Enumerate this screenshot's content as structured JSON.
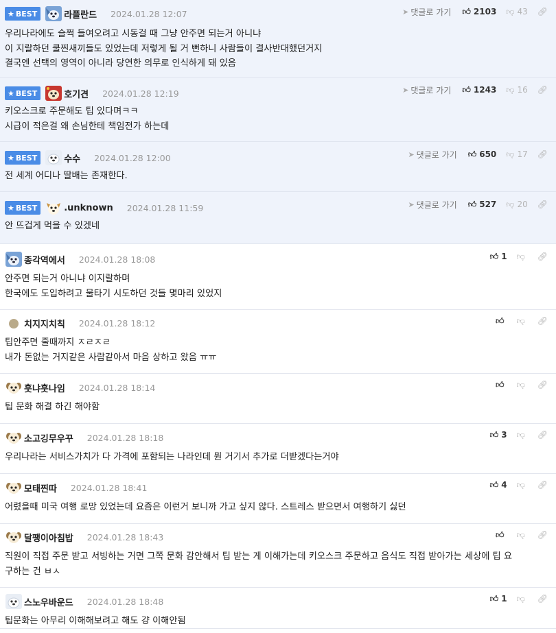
{
  "best_label": "BEST",
  "reply_label": "댓글로 가기",
  "colors": {
    "best_badge": "#4a8ce6",
    "best_bg": "#eff3fb"
  },
  "comments": [
    {
      "best": true,
      "nick": "라플란드",
      "date": "2024.01.28 12:07",
      "up": "2103",
      "down": "43",
      "avatar": "blue-puppy-icon",
      "lines": [
        "우리나라에도 슬쩍 들여오려고 시동걸 때 그냥 안주면 되는거 아니냐",
        "이 지랄하던 쿨찐새끼들도 있었는데 저렇게 될 거 뻔하니 사람들이 결사반대했던거지",
        "결국엔 선택의 영역이 아니라 당연한 의무로 인식하게 돼 있음"
      ]
    },
    {
      "best": true,
      "nick": "호기견",
      "date": "2024.01.28 12:19",
      "up": "1243",
      "down": "16",
      "avatar": "red-puppy-icon",
      "lines": [
        "키오스크로 주문해도 팁 있다며ㅋㅋ",
        "시급이 적은걸 왜 손님한테 책임전가 하는데"
      ]
    },
    {
      "best": true,
      "nick": "수수",
      "date": "2024.01.28 12:00",
      "up": "650",
      "down": "17",
      "avatar": "white-puppy-icon",
      "lines": [
        "전 세계 어디나 딸배는 존재한다."
      ]
    },
    {
      "best": true,
      "nick": ".unknown",
      "date": "2024.01.28 11:59",
      "up": "527",
      "down": "20",
      "avatar": "brown-puppy-icon",
      "lines": [
        "안 뜨겁게 먹을 수 있겠네"
      ]
    },
    {
      "best": false,
      "nick": "종각역에서",
      "date": "2024.01.28 18:08",
      "up": "1",
      "down": "",
      "avatar": "blue-puppy-icon",
      "lines": [
        "안주면 되는거 아니냐 이지랄하며",
        "한국에도 도입하려고 물타기 시도하던 것들 몇마리 있었지"
      ]
    },
    {
      "best": false,
      "nick": "치지지치칙",
      "date": "2024.01.28 18:12",
      "up": "",
      "down": "",
      "avatar": "gray-dot-icon",
      "lines": [
        "팁안주면 줄때까지 ㅈㄹㅈㄹ",
        "내가 돈없는 거지같은 사람같아서 마음 상하고 왔음 ㅠㅠ"
      ]
    },
    {
      "best": false,
      "nick": "훗냐훗나임",
      "date": "2024.01.28 18:14",
      "up": "",
      "down": "",
      "avatar": "dog-face-icon",
      "lines": [
        "팁 문화 해결 하긴 해야함"
      ]
    },
    {
      "best": false,
      "nick": "소고깅무우꾸",
      "date": "2024.01.28 18:18",
      "up": "3",
      "down": "",
      "avatar": "dog-face-icon",
      "lines": [
        "우리나라는 서비스가치가 다 가격에 포함되는 나라인데 뭔 거기서 추가로 더받겠다는거야"
      ]
    },
    {
      "best": false,
      "nick": "모태찐따",
      "date": "2024.01.28 18:41",
      "up": "4",
      "down": "",
      "avatar": "dog-face-icon",
      "lines": [
        "어렸을때 미국 여행 로망 있었는데 요즘은 이런거 보니까 가고 싶지 않다. 스트레스 받으면서 여행하기 싫던"
      ]
    },
    {
      "best": false,
      "nick": "달팽이아침밥",
      "date": "2024.01.28 18:43",
      "up": "",
      "down": "",
      "avatar": "dog-face-icon",
      "lines": [
        "직원이 직접 주문 받고 서빙하는 거면 그쪽 문화 감안해서 팁 받는 게 이해가는데 키오스크 주문하고 음식도 직접 받아가는 세상에 팁 요",
        "구하는 건 ㅂㅅ"
      ]
    },
    {
      "best": false,
      "nick": "스노우바운드",
      "date": "2024.01.28 18:48",
      "up": "1",
      "down": "",
      "avatar": "white-puppy-icon",
      "lines": [
        "팁문화는 아무리 이해해보려고 해도 걍 이해안됨"
      ]
    }
  ]
}
